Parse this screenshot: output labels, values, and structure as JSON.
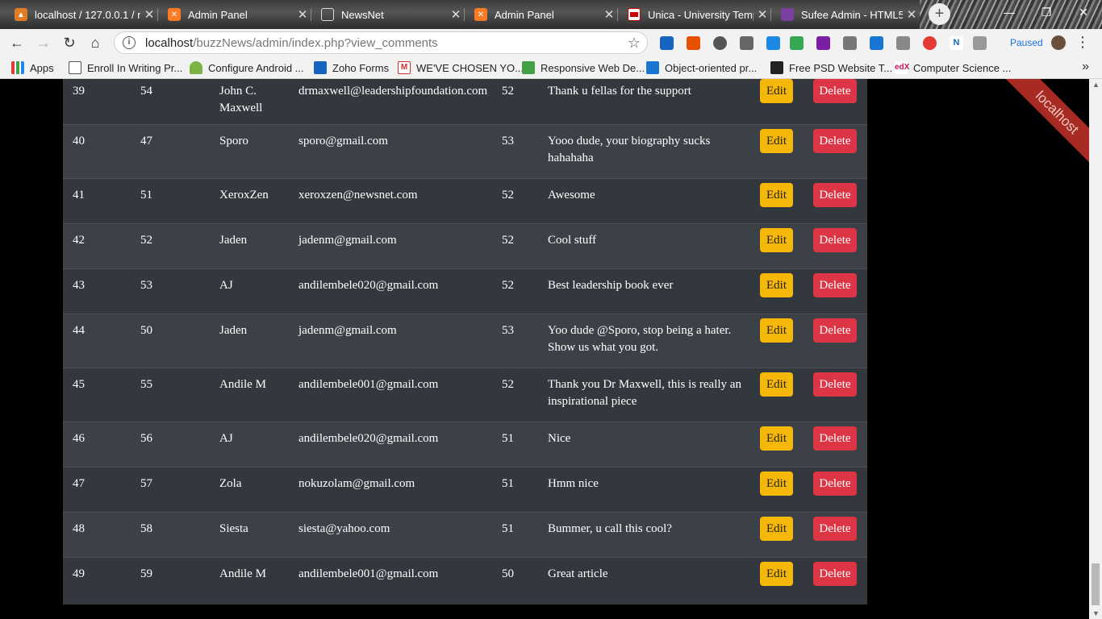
{
  "browser": {
    "tabs": [
      {
        "title": "localhost / 127.0.0.1 / n",
        "icon": "phpmyadmin-icon",
        "active": false
      },
      {
        "title": "Admin Panel",
        "icon": "xampp-icon",
        "active": false
      },
      {
        "title": "NewsNet",
        "icon": "page-icon",
        "active": false
      },
      {
        "title": "Admin Panel",
        "icon": "xampp-icon",
        "active": false
      },
      {
        "title": "Unica - University Temp",
        "icon": "unica-icon",
        "active": false
      },
      {
        "title": "Sufee Admin - HTML5",
        "icon": "colorlib-icon",
        "active": true
      }
    ],
    "url_host": "localhost",
    "url_path": "/buzzNews/admin/index.php?view_comments",
    "profile_status": "Paused",
    "bookmarks": [
      {
        "label": "Apps",
        "icon": "apps-grid-icon"
      },
      {
        "label": "Enroll In Writing Pr...",
        "icon": "page-icon"
      },
      {
        "label": "Configure Android ...",
        "icon": "android-icon"
      },
      {
        "label": "Zoho Forms",
        "icon": "zoho-icon"
      },
      {
        "label": "WE'VE CHOSEN YO...",
        "icon": "gmail-icon"
      },
      {
        "label": "Responsive Web De...",
        "icon": "fcc-icon"
      },
      {
        "label": "Object-oriented pr...",
        "icon": "laptop-icon"
      },
      {
        "label": "Free PSD Website T...",
        "icon": "psd-icon"
      },
      {
        "label": "Computer Science ...",
        "icon": "edx-icon"
      }
    ],
    "bookmarks_more": "»"
  },
  "ribbon_text": "localhost",
  "comments": {
    "edit_label": "Edit",
    "delete_label": "Delete",
    "rows": [
      {
        "id": "39",
        "post_id": "54",
        "name": "John C. Maxwell",
        "email": "drmaxwell@leadershipfoundation.com",
        "num": "52",
        "comment": "Thank u fellas for the support"
      },
      {
        "id": "40",
        "post_id": "47",
        "name": "Sporo",
        "email": "sporo@gmail.com",
        "num": "53",
        "comment": "Yooo dude, your biography sucks hahahaha"
      },
      {
        "id": "41",
        "post_id": "51",
        "name": "XeroxZen",
        "email": "xeroxzen@newsnet.com",
        "num": "52",
        "comment": "Awesome"
      },
      {
        "id": "42",
        "post_id": "52",
        "name": "Jaden",
        "email": "jadenm@gmail.com",
        "num": "52",
        "comment": "Cool stuff"
      },
      {
        "id": "43",
        "post_id": "53",
        "name": "AJ",
        "email": "andilembele020@gmail.com",
        "num": "52",
        "comment": "Best leadership book ever"
      },
      {
        "id": "44",
        "post_id": "50",
        "name": "Jaden",
        "email": "jadenm@gmail.com",
        "num": "53",
        "comment": "Yoo dude @Sporo, stop being a hater. Show us what you got."
      },
      {
        "id": "45",
        "post_id": "55",
        "name": "Andile M",
        "email": "andilembele001@gmail.com",
        "num": "52",
        "comment": "Thank you Dr Maxwell, this is really an inspirational piece"
      },
      {
        "id": "46",
        "post_id": "56",
        "name": "AJ",
        "email": "andilembele020@gmail.com",
        "num": "51",
        "comment": "Nice"
      },
      {
        "id": "47",
        "post_id": "57",
        "name": "Zola",
        "email": "nokuzolam@gmail.com",
        "num": "51",
        "comment": "Hmm nice"
      },
      {
        "id": "48",
        "post_id": "58",
        "name": "Siesta",
        "email": "siesta@yahoo.com",
        "num": "51",
        "comment": "Bummer, u call this cool?"
      },
      {
        "id": "49",
        "post_id": "59",
        "name": "Andile M",
        "email": "andilembele001@gmail.com",
        "num": "50",
        "comment": "Great article"
      }
    ]
  }
}
